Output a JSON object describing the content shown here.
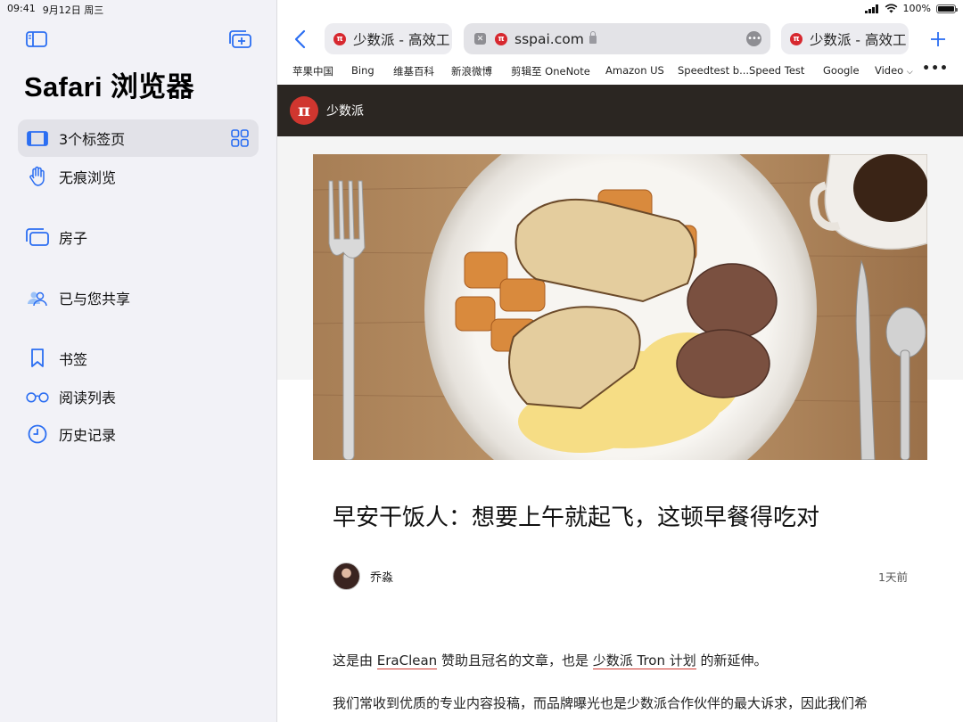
{
  "status": {
    "time": "09:41",
    "date": "9月12日 周三",
    "battery": "100%",
    "battery_level": 1.0
  },
  "sidebar": {
    "title": "Safari 浏览器",
    "items": [
      {
        "label": "3个标签页",
        "icon": "tabs-icon"
      },
      {
        "label": "无痕浏览",
        "icon": "hand-icon"
      },
      {
        "label": "房子",
        "icon": "tab-group-icon"
      },
      {
        "label": "已与您共享",
        "icon": "shared-with-you-icon"
      },
      {
        "label": "书签",
        "icon": "bookmark-icon"
      },
      {
        "label": "阅读列表",
        "icon": "glasses-icon"
      },
      {
        "label": "历史记录",
        "icon": "clock-icon"
      }
    ]
  },
  "tabs": [
    {
      "title": "少数派 - 高效工"
    },
    {
      "title": "sspai.com"
    },
    {
      "title": "少数派 - 高效工"
    }
  ],
  "favorites": [
    "苹果中国",
    "Bing",
    "维基百科",
    "新浪微博",
    "剪辑至 OneNote",
    "Amazon US",
    "Speedtest b...Speed Test",
    "Google",
    "Video"
  ],
  "site": {
    "logo": "π",
    "name": "少数派"
  },
  "article": {
    "title": "早安干饭人：想要上午就起飞，这顿早餐得吃对",
    "author": "乔淼",
    "time_ago": "1天前",
    "p1_prefix": "这是由 ",
    "p1_link1": "EraClean",
    "p1_mid": " 赞助且冠名的文章，也是 ",
    "p1_link2": "少数派 Tron 计划",
    "p1_suffix": " 的新延伸。",
    "p2": "我们常收到优质的专业内容投稿，而品牌曝光也是少数派合作伙伴的最大诉求，因此我们希"
  },
  "colors": {
    "accent": "#2b6ef2",
    "brand": "#d0362f",
    "header_bg": "#2b2622"
  }
}
